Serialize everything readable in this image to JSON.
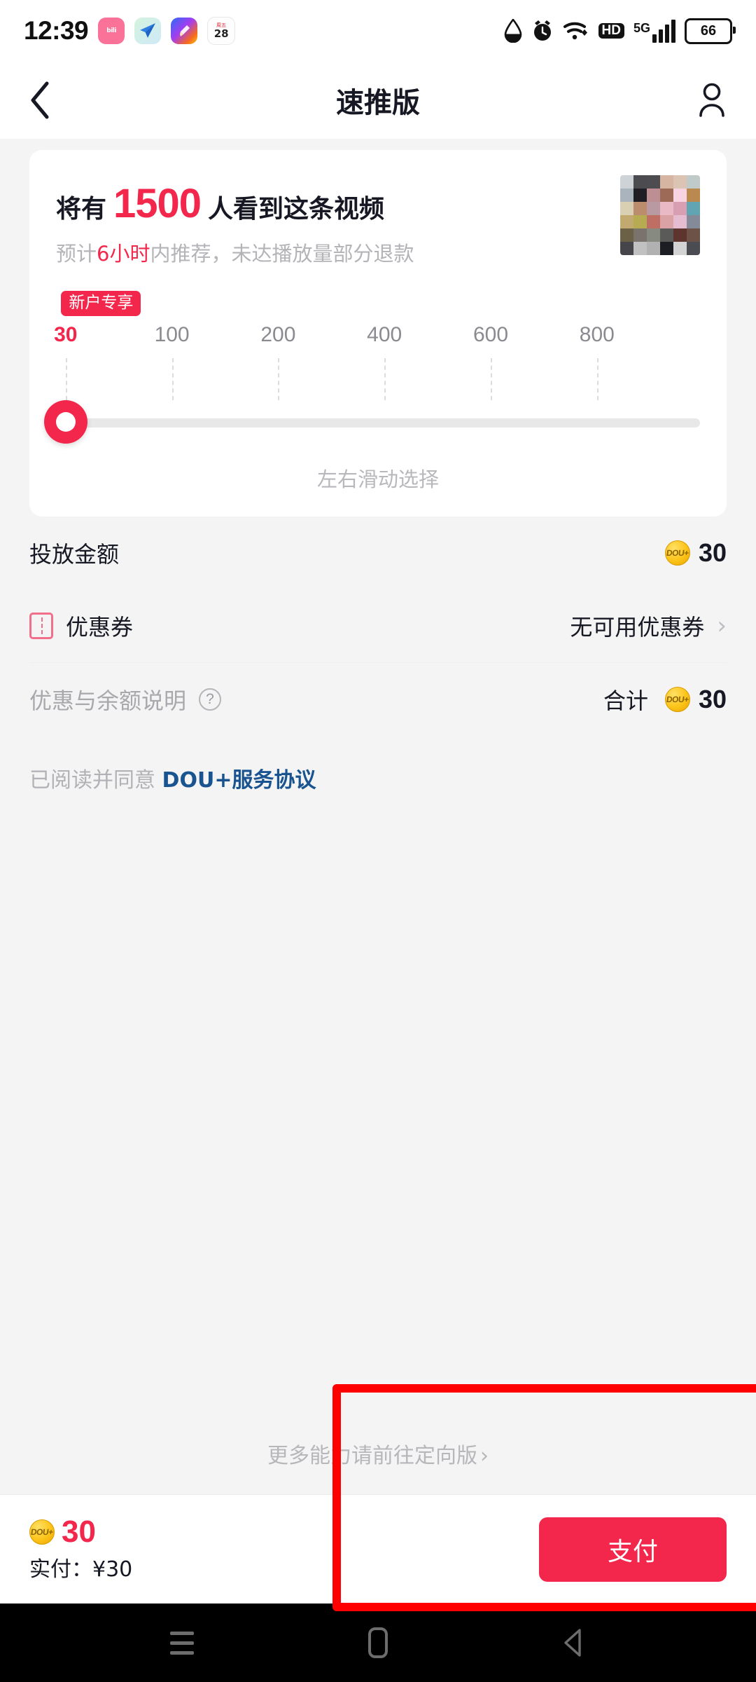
{
  "statusbar": {
    "time": "12:39",
    "apps": [
      {
        "name": "bilibili-app-icon",
        "label": "bili"
      },
      {
        "name": "paper-plane-app-icon",
        "label": ""
      },
      {
        "name": "gradient-app-icon",
        "label": ""
      },
      {
        "name": "calendar-app-icon",
        "top": "周五",
        "day": "28"
      }
    ],
    "icons": [
      "water-drop-icon",
      "alarm-clock-icon",
      "wifi-icon",
      "hd-icon",
      "5g-signal-icon",
      "battery-icon"
    ],
    "hd_label": "HD",
    "network_label": "5G",
    "battery_level": "66"
  },
  "header": {
    "title": "速推版",
    "back_icon": "back-chevron-icon",
    "user_icon": "user-profile-icon"
  },
  "card": {
    "headline_prefix": "将有",
    "headline_number": "1500",
    "headline_suffix": "人看到这条视频",
    "sub_prefix": "预计",
    "sub_highlight": "6小时",
    "sub_suffix": "内推荐，未达播放量部分退款",
    "thumbnail_name": "video-thumbnail"
  },
  "slider": {
    "badge": "新户专享",
    "selected_value": "30",
    "hint": "左右滑动选择",
    "ticks": [
      {
        "label": "30",
        "pos": 1.5,
        "active": true
      },
      {
        "label": "100",
        "pos": 18.0,
        "active": false
      },
      {
        "label": "200",
        "pos": 34.5,
        "active": false
      },
      {
        "label": "400",
        "pos": 51.0,
        "active": false
      },
      {
        "label": "600",
        "pos": 67.5,
        "active": false
      },
      {
        "label": "800",
        "pos": 84.0,
        "active": false
      }
    ],
    "thumb_pos": 1.5
  },
  "rows": {
    "amount_label": "投放金额",
    "amount_value": "30",
    "coupon_label": "优惠券",
    "coupon_value": "无可用优惠券",
    "coupon_chevron": "›",
    "explain_label": "优惠与余额说明",
    "explain_help": "?",
    "total_label": "合计",
    "total_value": "30",
    "coin_text": "DOU+"
  },
  "agreement": {
    "prefix": "已阅读并同意",
    "link": "DOU+服务协议"
  },
  "more": {
    "text": "更多能力请前往定向版",
    "chevron": "›"
  },
  "bottombar": {
    "total_value": "30",
    "actual_label": "实付：¥30",
    "pay_button": "支付"
  },
  "androidnav": {
    "recents": "recents-icon",
    "home": "home-icon",
    "back": "back-triangle-icon"
  },
  "colors": {
    "accent_red": "#f3274c",
    "annotation_red": "#ff0000",
    "coin_gold": "#fcc419",
    "link_blue": "#1a5490"
  },
  "thumbnail_pixels": [
    "#cdd3d6",
    "#4b4b50",
    "#4c4c51",
    "#d6b5a2",
    "#dcc4b5",
    "#c0cac8",
    "#a9b4bc",
    "#201d24",
    "#bd8e94",
    "#9d6a57",
    "#f8d3e2",
    "#b9894f",
    "#d9d0b4",
    "#bb8d6d",
    "#b99aa3",
    "#eab9c6",
    "#d89fb3",
    "#62a5b2",
    "#c2a96f",
    "#b6ab52",
    "#bf6e63",
    "#dba2a6",
    "#e6bcd1",
    "#848a98",
    "#6a6147",
    "#7a736c",
    "#878a81",
    "#5a5a58",
    "#5d342e",
    "#6d5247",
    "#45454a",
    "#c1c1c1",
    "#b1b1b1",
    "#1d1d24",
    "#d3d3d3",
    "#4b4b52"
  ]
}
